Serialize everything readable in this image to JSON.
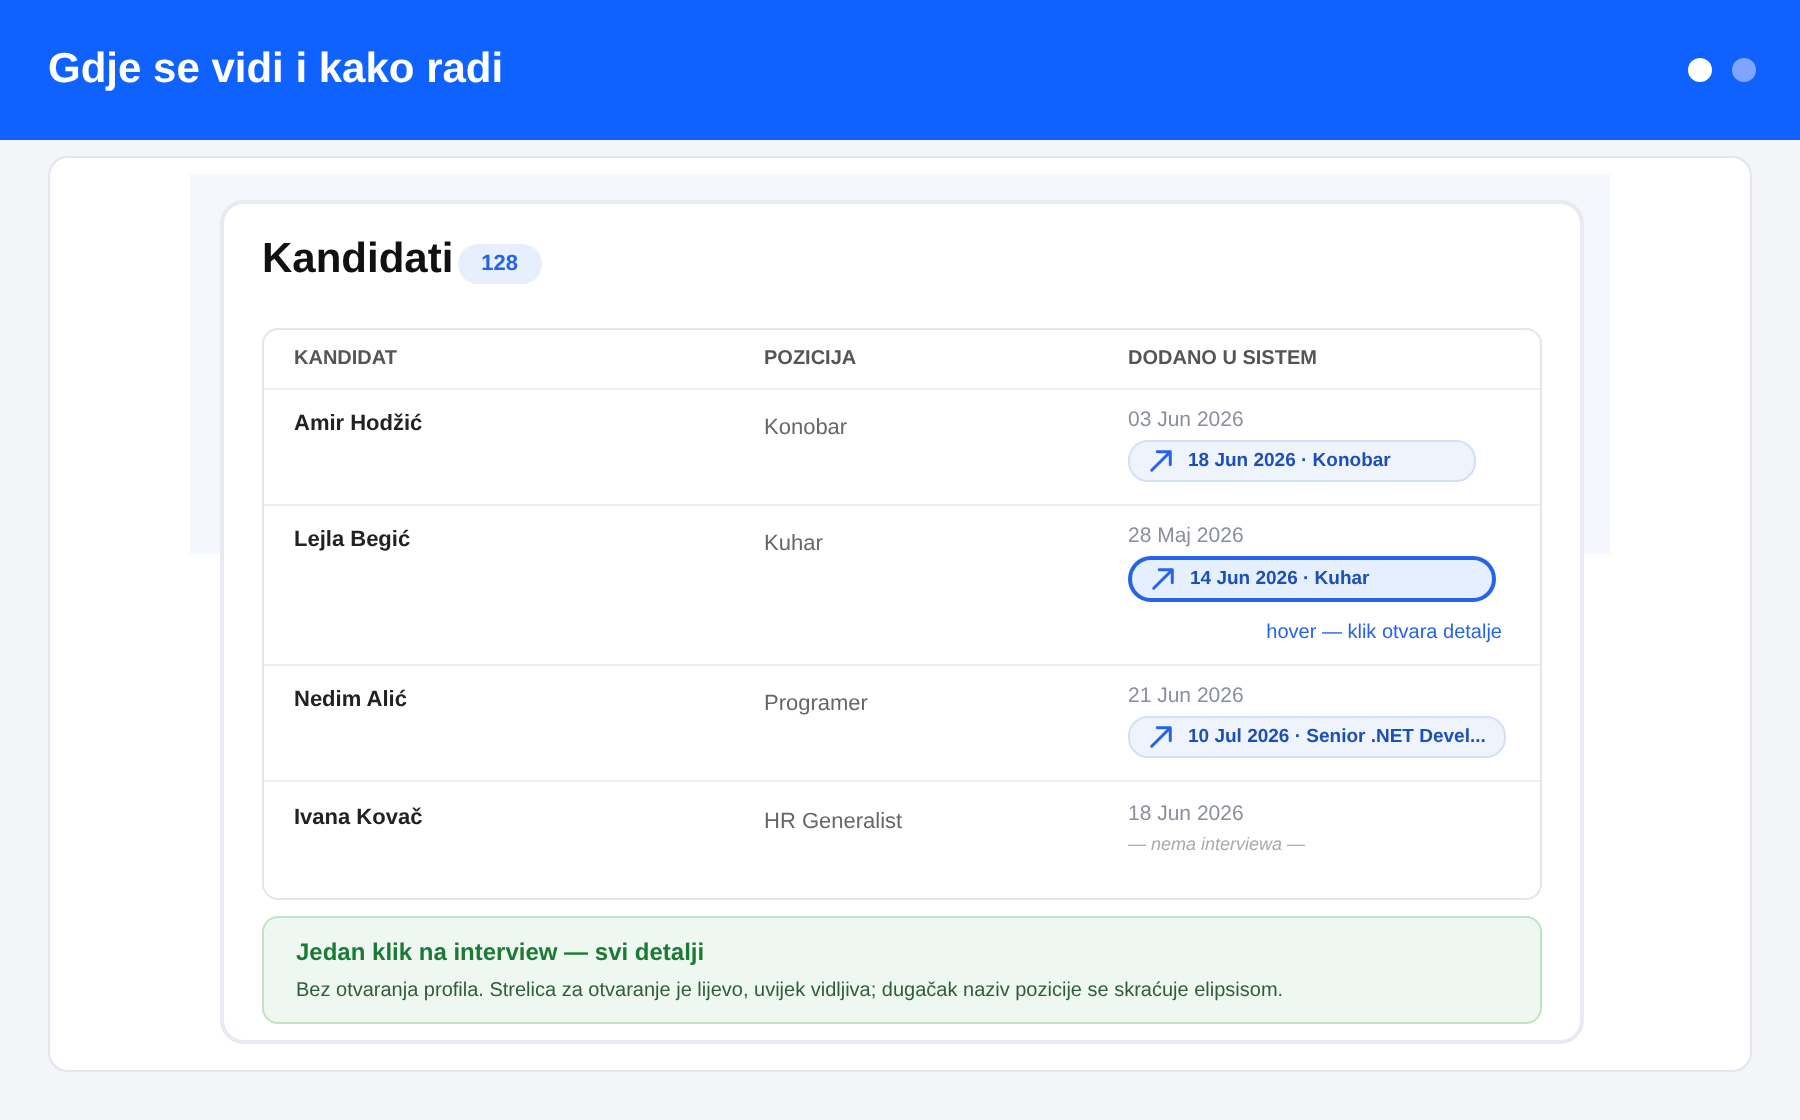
{
  "header": {
    "title": "Gdje se vidi i kako radi",
    "pager": [
      {
        "selected": true
      },
      {
        "selected": false
      }
    ]
  },
  "panel": {
    "title": "Kandidati",
    "count": "128"
  },
  "table": {
    "columns": [
      "KANDIDAT",
      "POZICIJA",
      "DODANO U SISTEM"
    ],
    "rows": [
      {
        "name": "Amir Hodžić",
        "position": "Konobar",
        "added": "03 Jun 2026",
        "interview": {
          "label": "18 Jun 2026 · Konobar",
          "hovered": false
        }
      },
      {
        "name": "Lejla Begić",
        "position": "Kuhar",
        "added": "28 Maj 2026",
        "interview": {
          "label": "14 Jun 2026 · Kuhar",
          "hovered": true,
          "hint": "hover — klik otvara detalje"
        }
      },
      {
        "name": "Nedim Alić",
        "position": "Programer",
        "added": "21 Jun 2026",
        "interview": {
          "label": "10 Jul 2026 · Senior .NET Devel...",
          "hovered": false
        }
      },
      {
        "name": "Ivana Kovač",
        "position": "HR Generalist",
        "added": "18 Jun 2026",
        "empty_text": "— nema interviewa —"
      }
    ]
  },
  "note": {
    "title": "Jedan klik na interview — svi detalji",
    "text": "Bez otvaranja profila. Strelica za otvaranje je lijevo, uvijek vidljiva; dugačak naziv pozicije se skraćuje elipsisom."
  }
}
